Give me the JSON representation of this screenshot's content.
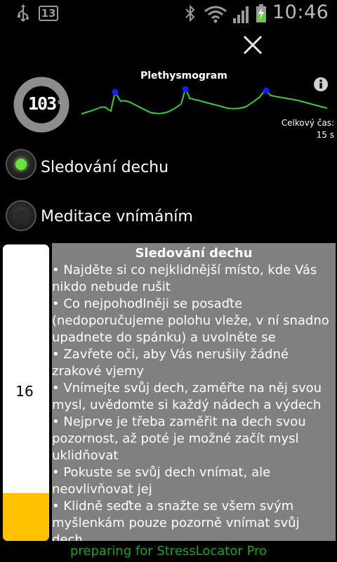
{
  "status_bar": {
    "time": "10:46",
    "notification_count": "13",
    "icons": [
      "usb-icon",
      "notification-badge",
      "bluetooth-icon",
      "wifi-icon",
      "signal-icon",
      "battery-charging-icon"
    ]
  },
  "timer": {
    "value": "103",
    "unit": "s"
  },
  "plethysmogram": {
    "title": "Plethysmogram",
    "line_color": "#3ec93e",
    "peak_color": "#1a1aff"
  },
  "total_time": {
    "label": "Celkový čas:",
    "value": "15 s"
  },
  "modes": [
    {
      "label": "Sledování dechu",
      "selected": true
    },
    {
      "label": "Meditace vnímáním",
      "selected": false
    }
  ],
  "gauge": {
    "value": "16",
    "fill_color": "#ffc000",
    "fill_fraction": 0.16
  },
  "instructions": {
    "title": "Sledování dechu",
    "items": [
      "• Najděte si co nejklidnější místo, kde Vás nikdo nebude rušit",
      " • Co nejpohodlněji se posaďte (nedoporučujeme polohu vleže, v ní snadno upadnete do spánku) a uvolněte se",
      " • Zavřete oči, aby Vás nerušily žádné zrakové vjemy",
      " • Vnímejte svůj dech, zaměřte na něj svou mysl, uvědomte si každý nádech a výdech",
      " • Nejprve je třeba zaměřit na dech svou pozornost, až poté je možné začít mysl uklidňovat",
      " • Pokuste se svůj dech vnímat, ale neovlivňovat jej",
      " • Klidně seďte a snažte se všem svým myšlenkám pouze pozorně vnímat svůj dech"
    ]
  },
  "footer": {
    "text": "preparing for StressLocator Pro"
  }
}
